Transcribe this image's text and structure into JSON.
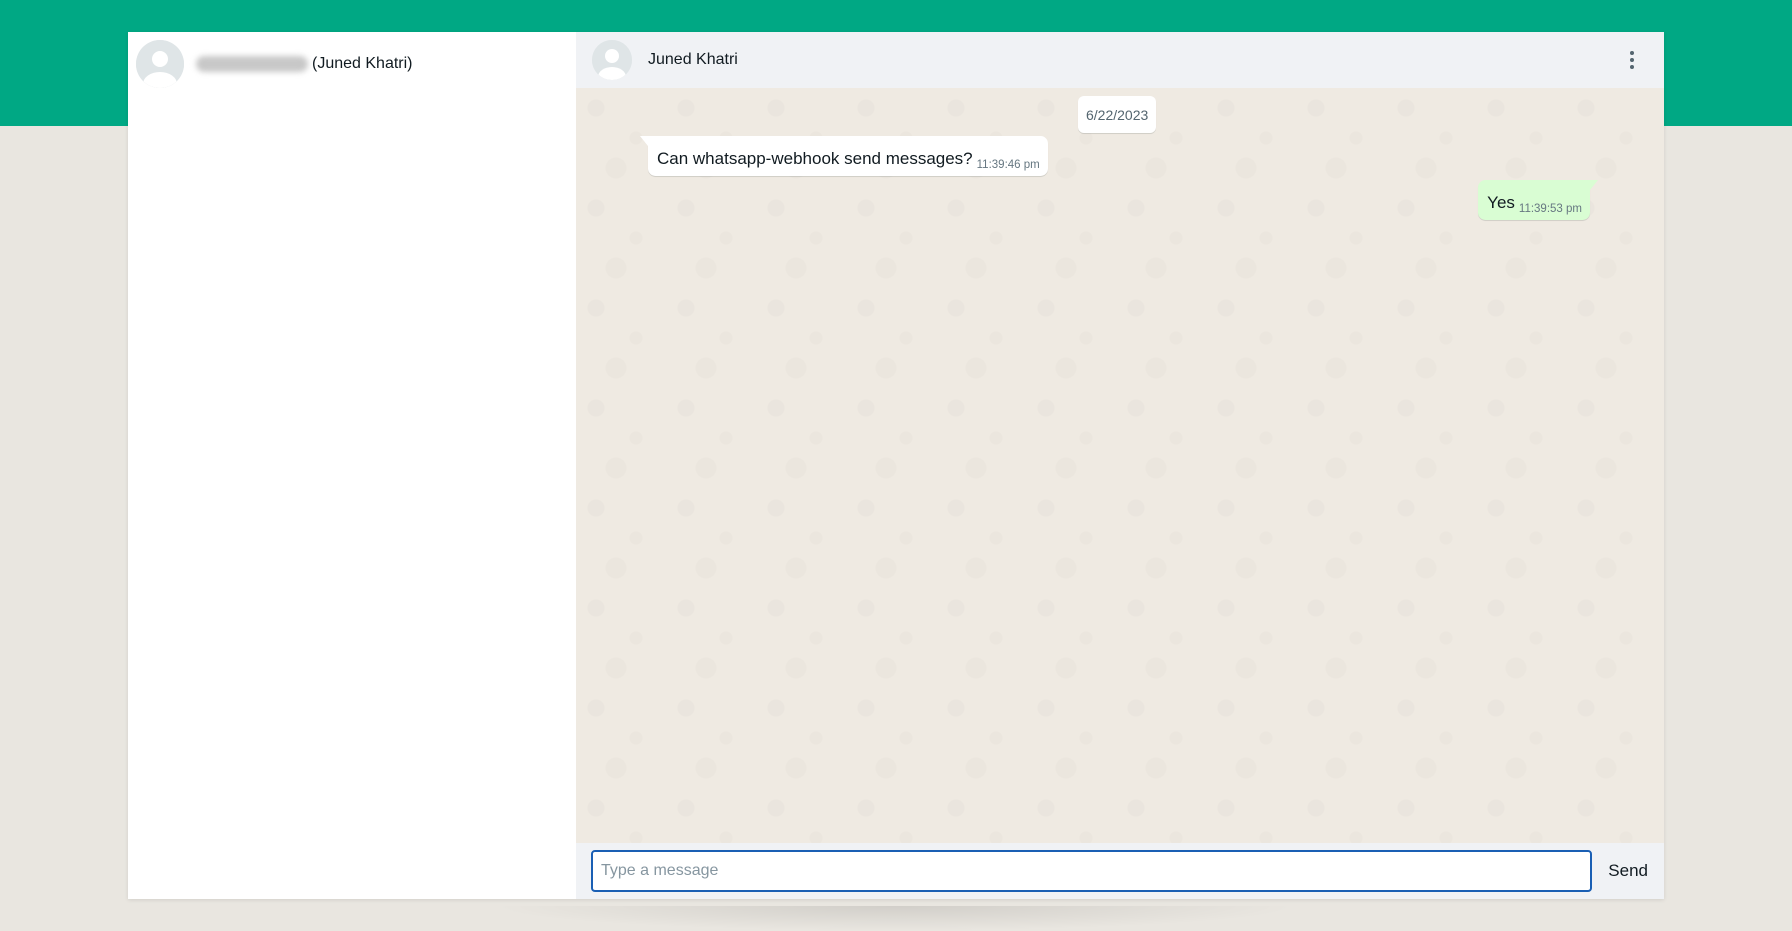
{
  "sidebar": {
    "chats": [
      {
        "name_suffix": "(Juned Khatri)",
        "avatar_icon": "default-avatar-icon"
      }
    ]
  },
  "conversation": {
    "header": {
      "title": "Juned Khatri",
      "menu_icon": "more-vertical-icon"
    },
    "date_chip": "6/22/2023",
    "messages": [
      {
        "direction": "incoming",
        "text": "Can whatsapp-webhook send messages?",
        "time": "11:39:46 pm"
      },
      {
        "direction": "outgoing",
        "text": "Yes",
        "time": "11:39:53 pm"
      }
    ],
    "composer": {
      "placeholder": "Type a message",
      "value": "",
      "send_label": "Send"
    }
  },
  "colors": {
    "brand_band": "#00a884",
    "page_bg": "#e9e6e0",
    "chat_bg": "#efeae2",
    "outgoing_bubble": "#d9fdd3",
    "input_focus_border": "#1a5fb4"
  }
}
